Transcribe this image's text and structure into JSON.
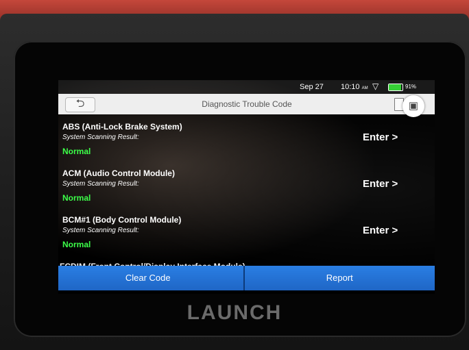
{
  "statusbar": {
    "date": "Sep 27",
    "time": "10:10",
    "time_suffix": "AM",
    "battery_text": "91%",
    "battery_level": 0.91,
    "battery_color": "#36d136",
    "wifi_icon": "wifi-icon"
  },
  "titlebar": {
    "back_icon": "back-arrow-icon",
    "title": "Diagnostic Trouble Code",
    "doc_icon": "document-icon",
    "camera_icon": "camera-icon"
  },
  "systems": [
    {
      "name": "ABS (Anti-Lock Brake System)",
      "result_label": "System Scanning Result:",
      "status": "Normal",
      "action": "Enter >"
    },
    {
      "name": "ACM (Audio Control Module)",
      "result_label": "System Scanning Result:",
      "status": "Normal",
      "action": "Enter >"
    },
    {
      "name": "BCM#1 (Body Control Module)",
      "result_label": "System Scanning Result:",
      "status": "Normal",
      "action": "Enter >"
    }
  ],
  "partial_row": "FCDIM (Front Control/Display Interface Module)",
  "buttons": {
    "clear": "Clear Code",
    "report": "Report",
    "color": "#2a7ee3"
  },
  "brand": "LAUNCH",
  "colors": {
    "normal_status": "#3cff49",
    "device_red": "#c4473b"
  }
}
